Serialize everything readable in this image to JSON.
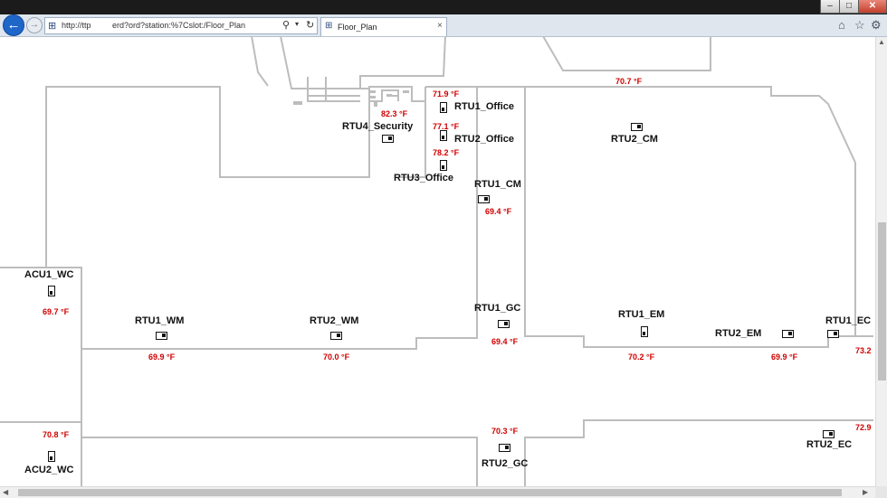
{
  "browser": {
    "address": "http://ttp             erd?ord?station:%7Cslot:/Floor_Plan",
    "tab_title": "Floor_Plan",
    "tab_close": "×",
    "back_icon": "←",
    "forward_icon": "→",
    "window_buttons": {
      "minimize": "–",
      "maximize": "□",
      "close": "✕"
    },
    "toolbar_icons": [
      "home-icon",
      "star-icon",
      "gear-icon"
    ]
  },
  "equipment": [
    {
      "id": "rtu1-office",
      "name": "RTU1_Office",
      "temp": "71.9 °F"
    },
    {
      "id": "rtu4-security",
      "name": "RTU4_Security",
      "temp": "82.3 °F"
    },
    {
      "id": "rtu2-office",
      "name": "RTU2_Office",
      "temp": "77.1 °F"
    },
    {
      "id": "rtu3-office",
      "name": "RTU3_Office",
      "temp": "78.2 °F"
    },
    {
      "id": "rtu2-cm",
      "name": "RTU2_CM",
      "temp": "70.7 °F"
    },
    {
      "id": "rtu1-cm",
      "name": "RTU1_CM",
      "temp": "69.4 °F"
    },
    {
      "id": "acu1-wc",
      "name": "ACU1_WC",
      "temp": "69.7 °F"
    },
    {
      "id": "rtu1-wm",
      "name": "RTU1_WM",
      "temp": "69.9 °F"
    },
    {
      "id": "rtu2-wm",
      "name": "RTU2_WM",
      "temp": "70.0 °F"
    },
    {
      "id": "rtu1-gc",
      "name": "RTU1_GC",
      "temp": "69.4 °F"
    },
    {
      "id": "rtu1-em",
      "name": "RTU1_EM",
      "temp": "70.2 °F"
    },
    {
      "id": "rtu2-em",
      "name": "RTU2_EM",
      "temp": "69.9 °F"
    },
    {
      "id": "rtu1-ec",
      "name": "RTU1_EC",
      "temp": "73.2"
    },
    {
      "id": "acu2-wc",
      "name": "ACU2_WC",
      "temp": "70.8 °F"
    },
    {
      "id": "rtu2-gc",
      "name": "RTU2_GC",
      "temp": "70.3 °F"
    },
    {
      "id": "rtu2-ec",
      "name": "RTU2_EC",
      "temp": "72.9"
    }
  ],
  "colors": {
    "wall": "#bdbdbd",
    "temperature": "#d00000",
    "label": "#111111",
    "browser_accent": "#1f66c9"
  }
}
